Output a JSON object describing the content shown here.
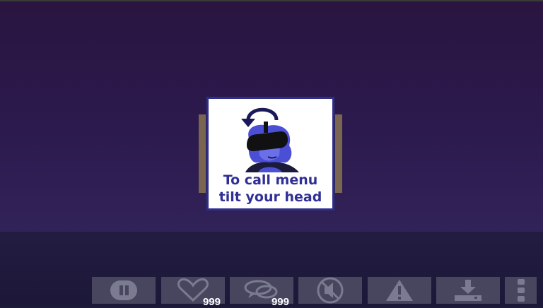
{
  "hint": {
    "line1": "To call menu",
    "line2": "tilt your head"
  },
  "toolbar": {
    "buttons": [
      {
        "name": "pause",
        "icon": "pause-icon"
      },
      {
        "name": "like",
        "icon": "heart-icon",
        "count": "999"
      },
      {
        "name": "comments",
        "icon": "chat-bubbles-icon",
        "count": "999"
      },
      {
        "name": "mute",
        "icon": "speaker-muted-icon"
      },
      {
        "name": "report",
        "icon": "warning-icon"
      },
      {
        "name": "download",
        "icon": "download-icon"
      },
      {
        "name": "more",
        "icon": "more-vertical-icon"
      }
    ]
  },
  "colors": {
    "scene_top": "#2a1540",
    "scene_bottom": "#312258",
    "floor": "#1e1a3a",
    "toolbar_button": "#47465e",
    "icon": "#7a7a90",
    "hint_text": "#2f2f95",
    "hint_border": "#2e2f8a",
    "figure_blue": "#4a4fd6"
  }
}
